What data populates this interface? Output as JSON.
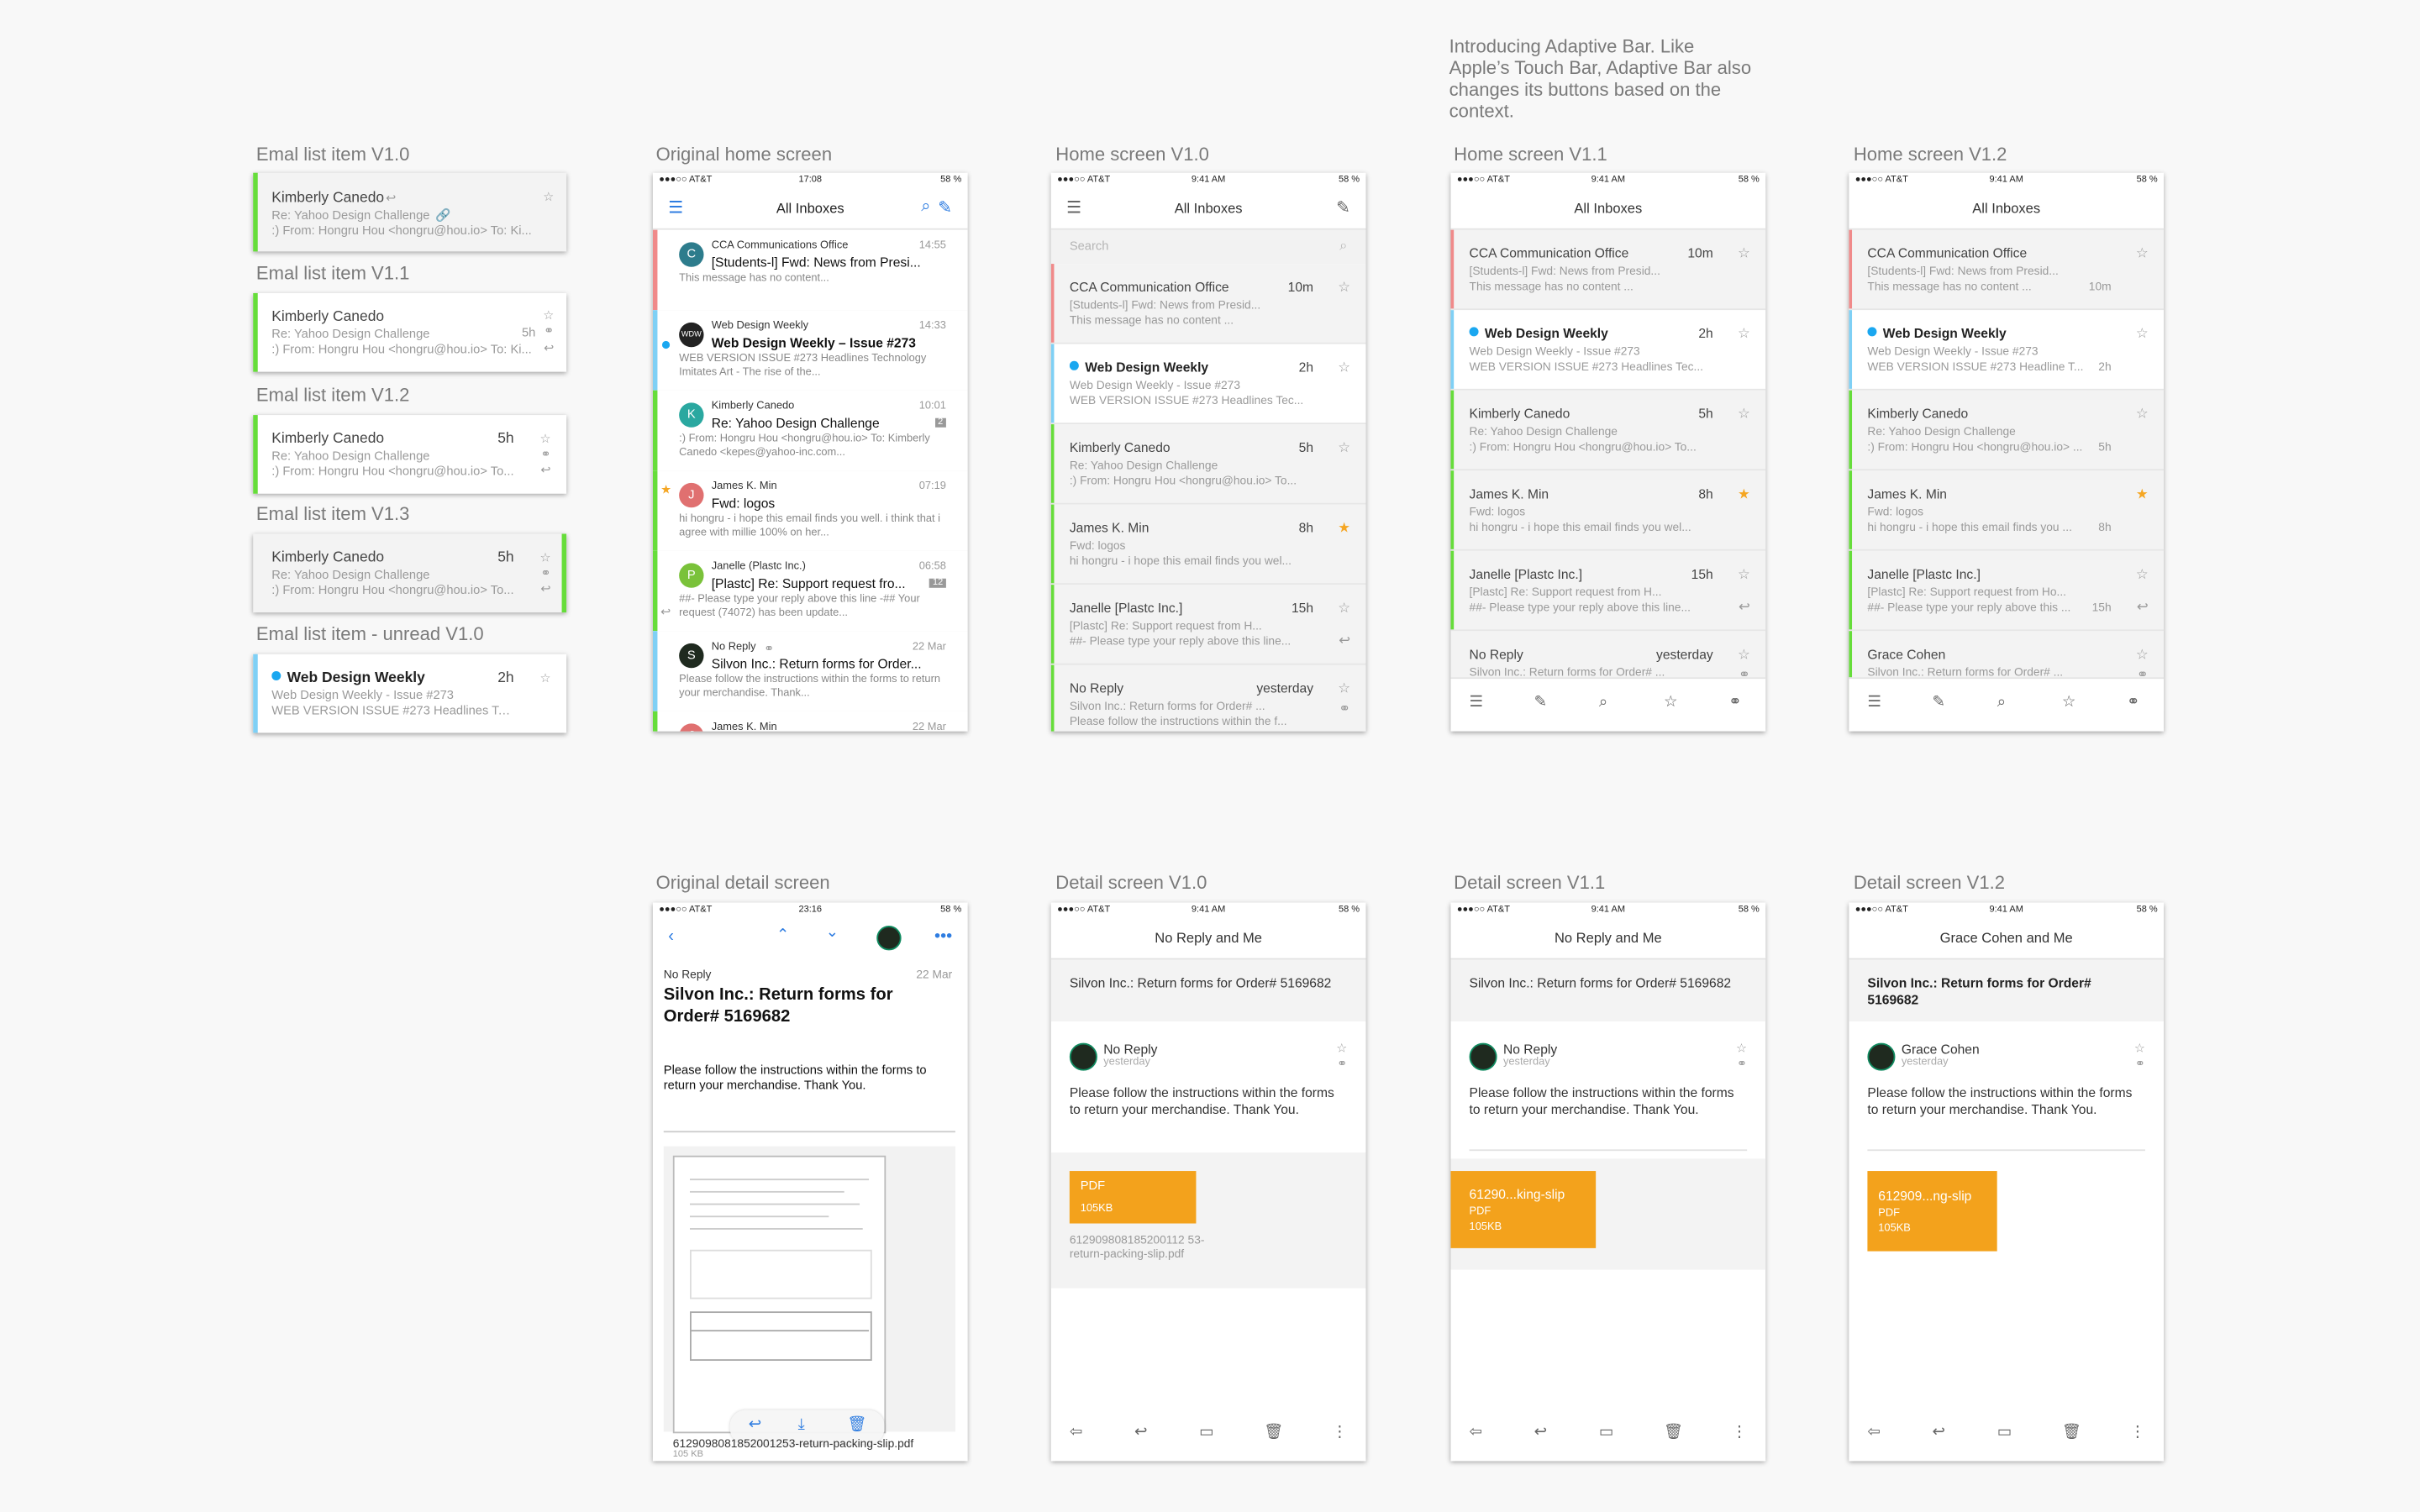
{
  "intro_text": "Introducing Adaptive Bar. Like Apple’s Touch Bar, Adaptive Bar also changes its buttons based on the context.",
  "labels": {
    "item_v10": "Emal list item V1.0",
    "item_v11": "Emal list item V1.1",
    "item_v12": "Emal list item V1.2",
    "item_v13": "Emal list item V1.3",
    "item_unread": "Emal list item - unread V1.0",
    "orig_home": "Original home screen",
    "home_v10": "Home screen V1.0",
    "home_v11": "Home screen V1.1",
    "home_v12": "Home screen V1.2",
    "orig_detail": "Original detail screen",
    "detail_v10": "Detail screen V1.0",
    "detail_v11": "Detail screen V1.1",
    "detail_v12": "Detail screen V1.2"
  },
  "colors": {
    "red": "#f08a8a",
    "green": "#66dd3a",
    "blue": "#7fd0f5",
    "accent": "#1aa7f0",
    "attachment": "#f3a21c",
    "star": "#f5a623"
  },
  "items": {
    "sender": "Kimberly Canedo",
    "subject": "Re: Yahoo Design Challenge",
    "preview": ":) From: Hongru Hou <hongru@hou.io> To: Ki...",
    "preview2": ":) From: Hongru Hou <hongru@hou.io> To...",
    "time": "5h",
    "unread_sender": "Web Design Weekly",
    "unread_subject": "Web Design Weekly - Issue #273",
    "unread_preview": "WEB VERSION ISSUE #273 Headlines Tec...",
    "unread_time": "2h"
  },
  "status": {
    "carrier": "●●●○○ AT&T",
    "time": "9:41 AM",
    "battery": "58 %",
    "orig_time": "17:08",
    "orig_battery": "58 %",
    "orig_detail_time": "23:16"
  },
  "inbox_title": "All Inboxes",
  "search_placeholder": "Search",
  "orig_home": {
    "rows": [
      {
        "from": "CCA Communications Office",
        "subject": "[Students-l] Fwd: News from Presi...",
        "preview": "This message has no content...",
        "time": "14:55",
        "avatar": "C"
      },
      {
        "from": "Web Design Weekly",
        "subject": "Web Design Weekly – Issue #273",
        "preview": "WEB VERSION ISSUE #273 Headlines Technology Imitates Art - The rise of the...",
        "time": "14:33",
        "avatar": "WDW"
      },
      {
        "from": "Kimberly Canedo",
        "subject": "Re: Yahoo Design Challenge",
        "preview": ":) From: Hongru Hou <hongru@hou.io> To: Kimberly Canedo <kepes@yahoo-inc.com...",
        "time": "10:01",
        "avatar": "K",
        "count": "2"
      },
      {
        "from": "James K. Min",
        "subject": "Fwd: logos",
        "preview": "hi hongru - i hope this email finds you well. i think that i agree with millie 100% on her...",
        "time": "07:19",
        "avatar": "J"
      },
      {
        "from": "Janelle (Plastc Inc.)",
        "subject": "[Plastc] Re: Support request fro...",
        "preview": "##- Please type your reply above this line -## Your request (74072) has been update...",
        "time": "06:58",
        "avatar": "P",
        "count": "12"
      },
      {
        "from": "No Reply",
        "subject": "Silvon Inc.: Return forms for Order...",
        "preview": "Please follow the instructions within the forms to return your merchandise. Thank...",
        "time": "22 Mar",
        "avatar": "S"
      },
      {
        "from": "James K. Min",
        "subject": "",
        "preview": "",
        "time": "22 Mar",
        "avatar": "J"
      }
    ]
  },
  "home_rows_v10": [
    {
      "sender": "CCA Communication Office",
      "subject": "[Students-l] Fwd: News from Presid...",
      "preview": "This message has no content ...",
      "time": "10m"
    },
    {
      "sender": "Web Design Weekly",
      "subject": "Web Design Weekly - Issue #273",
      "preview": "WEB VERSION ISSUE #273 Headlines Tec...",
      "time": "2h"
    },
    {
      "sender": "Kimberly Canedo",
      "subject": "Re: Yahoo Design Challenge",
      "preview": ":) From: Hongru Hou <hongru@hou.io> To...",
      "time": "5h"
    },
    {
      "sender": "James K. Min",
      "subject": "Fwd: logos",
      "preview": "hi hongru - i hope this email finds you wel...",
      "time": "8h"
    },
    {
      "sender": "Janelle [Plastc Inc.]",
      "subject": "[Plastc] Re: Support request from H...",
      "preview": "##- Please type your reply above this line...",
      "time": "15h"
    },
    {
      "sender": "No Reply",
      "subject": "Silvon Inc.: Return forms for Order# ...",
      "preview": "Please follow the instructions within the f...",
      "time": "yesterday"
    }
  ],
  "home_rows_v12": [
    {
      "sender": "CCA Communication Office",
      "subject": "[Students-l] Fwd: News from Presid...",
      "preview": "This message has no content ...",
      "time": "10m"
    },
    {
      "sender": "Web Design Weekly",
      "subject": "Web Design Weekly - Issue #273",
      "preview": "WEB VERSION ISSUE #273 Headline T...",
      "time": "2h"
    },
    {
      "sender": "Kimberly Canedo",
      "subject": "Re: Yahoo Design Challenge",
      "preview": ":) From: Hongru Hou <hongru@hou.io> ...",
      "time": "5h"
    },
    {
      "sender": "James K. Min",
      "subject": "Fwd: logos",
      "preview": "hi hongru - i hope this email finds you ...",
      "time": "8h"
    },
    {
      "sender": "Janelle [Plastc Inc.]",
      "subject": "[Plastc] Re: Support request from Ho...",
      "preview": "##- Please type your reply above this ...",
      "time": "15h"
    },
    {
      "sender": "Grace Cohen",
      "subject": "Silvon Inc.: Return forms for Order# ...",
      "preview": "",
      "time": ""
    }
  ],
  "orig_detail": {
    "sender": "No Reply",
    "date": "22 Mar",
    "subject": "Silvon Inc.: Return forms for Order# 5169682",
    "body": "Please follow the instructions within the forms to return your merchandise. Thank You.",
    "file": "6129098081852001253-return-packing-slip.pdf",
    "size": "105 KB"
  },
  "detail": {
    "title_v10": "No Reply and Me",
    "title_v12": "Grace Cohen and Me",
    "subject": "Silvon Inc.: Return forms for Order# 5169682",
    "sender": "No Reply",
    "sender_v12": "Grace Cohen",
    "time": "yesterday",
    "body": "Please follow the instructions within the forms to return your merchandise. Thank You.",
    "pdf": "PDF",
    "size": "105KB",
    "file_v10": "612909808185200112 53-return-packing-slip.pdf",
    "file_v11": "61290...king-slip",
    "file_v12": "612909...ng-slip"
  }
}
